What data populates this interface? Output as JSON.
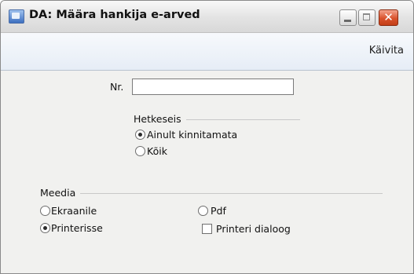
{
  "window": {
    "title": "DA: Määra hankija e-arved"
  },
  "toolbar": {
    "run_label": "Käivita"
  },
  "form": {
    "nr_label": "Nr.",
    "nr_value": "",
    "hetkeseis": {
      "title": "Hetkeseis",
      "options": [
        "Ainult kinnitamata",
        "Kõik"
      ],
      "selected": "Ainult kinnitamata"
    },
    "meedia": {
      "title": "Meedia",
      "options": [
        "Ekraanile",
        "Printerisse",
        "Pdf"
      ],
      "selected": "Printerisse"
    },
    "printer_dialog": {
      "label": "Printeri dialoog",
      "checked": false
    }
  },
  "colors": {
    "close_button": "#d9522c",
    "toolbar_bg": "#e6edf6",
    "window_bg": "#f1f1ef"
  }
}
